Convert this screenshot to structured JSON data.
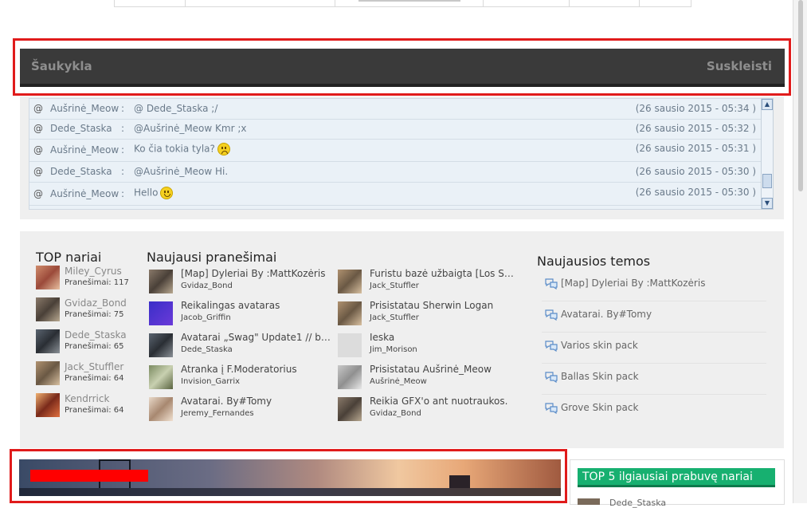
{
  "shoutbox": {
    "title": "Šaukykla",
    "collapse": "Suskleisti",
    "rows": [
      {
        "user": "Aušrinė_Meow",
        "message": "@ Dede_Staska ;/",
        "time": "(26 sausio 2015 - 05:34 )",
        "emoji": ""
      },
      {
        "user": "Dede_Staska",
        "message": "@Aušrinė_Meow Kmr ;x",
        "time": "(26 sausio 2015 - 05:32 )",
        "emoji": ""
      },
      {
        "user": "Aušrinė_Meow",
        "message": "Ko čia tokia tyla?",
        "time": "(26 sausio 2015 - 05:31 )",
        "emoji": "sad"
      },
      {
        "user": "Dede_Staska",
        "message": "@Aušrinė_Meow Hi.",
        "time": "(26 sausio 2015 - 05:30 )",
        "emoji": ""
      },
      {
        "user": "Aušrinė_Meow",
        "message": "Hello",
        "time": "(26 sausio 2015 - 05:30 )",
        "emoji": "smile"
      }
    ],
    "at_symbol": "@",
    "separator": ":"
  },
  "top_members": {
    "title": "TOP nariai",
    "items": [
      {
        "name": "Miley_Cyrus",
        "posts": "Pranešimai: 117"
      },
      {
        "name": "Gvidaz_Bond",
        "posts": "Pranešimai: 75"
      },
      {
        "name": "Dede_Staska",
        "posts": "Pranešimai: 65"
      },
      {
        "name": "Jack_Stuffler",
        "posts": "Pranešimai: 64"
      },
      {
        "name": "Kendrrick",
        "posts": "Pranešimai: 64"
      }
    ]
  },
  "latest_posts": {
    "title": "Naujausi pranešimai",
    "left": [
      {
        "title": "[Map] Dyleriai By :MattKozėris",
        "author": "Gvidaz_Bond"
      },
      {
        "title": "Reikalingas avataras",
        "author": "Jacob_Griffin"
      },
      {
        "title": "Avatarai „Swag\" Update1 // by…",
        "author": "Dede_Staska"
      },
      {
        "title": "Atranka į F.Moderatorius",
        "author": "Invision_Garrix"
      },
      {
        "title": "Avatarai. By#Tomy",
        "author": "Jeremy_Fernandes"
      }
    ],
    "right": [
      {
        "title": "Furistu bazė užbaigta [Los Sa…",
        "author": "Jack_Stuffler"
      },
      {
        "title": "Prisistatau Sherwin Logan",
        "author": "Jack_Stuffler"
      },
      {
        "title": "Ieska",
        "author": "Jim_Morison"
      },
      {
        "title": "Prisistatau Aušrinė_Meow",
        "author": "Aušrinė_Meow"
      },
      {
        "title": "Reikia GFX'o ant nuotraukos.",
        "author": "Gvidaz_Bond"
      }
    ]
  },
  "latest_topics": {
    "title": "Naujausios temos",
    "items": [
      "[Map] Dyleriai By :MattKozėris",
      "Avatarai. By#Tomy",
      "Varios skin pack",
      "Ballas Skin pack",
      "Grove Skin pack"
    ]
  },
  "top5": {
    "title": "TOP 5 ilgiausiai prabuvę nariai",
    "first_partial": "Dede_Staska"
  },
  "colors": {
    "highlight": "#e01b1b",
    "header_bg": "#3a3a3a",
    "top5_green": "#17b070"
  }
}
